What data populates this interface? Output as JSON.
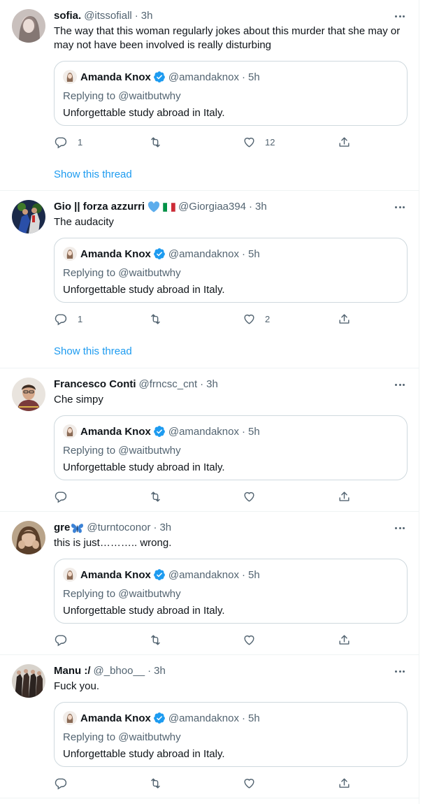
{
  "colors": {
    "accent": "#1d9bf0",
    "muted": "#536471",
    "text": "#0f1419",
    "border": "#cfd9de",
    "verified": "#1d9bf0"
  },
  "icons": {
    "reply": "reply-icon",
    "retweet": "retweet-icon",
    "like": "heart-icon",
    "share": "share-icon",
    "more": "more-icon",
    "verified": "verified-badge-icon"
  },
  "tweets": [
    {
      "name": "sofia.",
      "handle": "@itssofiall",
      "dot": "·",
      "time": "3h",
      "text": "The way that this woman regularly jokes about this murder that she may or may not have been involved is really disturbing",
      "quote": {
        "name": "Amanda Knox",
        "handle": "@amandaknox",
        "dot": "·",
        "time": "5h",
        "reply": "Replying to @waitbutwhy",
        "text": "Unforgettable study abroad in Italy."
      },
      "replies": "1",
      "retweets": "",
      "likes": "12",
      "thread": "Show this thread"
    },
    {
      "name": "Gio || forza azzurri",
      "handle": "@Giorgiaa394",
      "dot": "·",
      "time": "3h",
      "text": "The audacity",
      "quote": {
        "name": "Amanda Knox",
        "handle": "@amandaknox",
        "dot": "·",
        "time": "5h",
        "reply": "Replying to @waitbutwhy",
        "text": "Unforgettable study abroad in Italy."
      },
      "replies": "1",
      "retweets": "",
      "likes": "2",
      "thread": "Show this thread"
    },
    {
      "name": "Francesco Conti",
      "handle": "@frncsc_cnt",
      "dot": "·",
      "time": "3h",
      "text": "Che simpy",
      "quote": {
        "name": "Amanda Knox",
        "handle": "@amandaknox",
        "dot": "·",
        "time": "5h",
        "reply": "Replying to @waitbutwhy",
        "text": "Unforgettable study abroad in Italy."
      },
      "replies": "",
      "retweets": "",
      "likes": ""
    },
    {
      "name": "gre",
      "handle": "@turntoconor",
      "dot": "·",
      "time": "3h",
      "text": "this is just……….. wrong.",
      "quote": {
        "name": "Amanda Knox",
        "handle": "@amandaknox",
        "dot": "·",
        "time": "5h",
        "reply": "Replying to @waitbutwhy",
        "text": "Unforgettable study abroad in Italy."
      },
      "replies": "",
      "retweets": "",
      "likes": ""
    },
    {
      "name": "Manu :/",
      "handle": "@_bhoo__",
      "dot": "·",
      "time": "3h",
      "text": "Fuck you.",
      "quote": {
        "name": "Amanda Knox",
        "handle": "@amandaknox",
        "dot": "·",
        "time": "5h",
        "reply": "Replying to @waitbutwhy",
        "text": "Unforgettable study abroad in Italy."
      },
      "replies": "",
      "retweets": "",
      "likes": ""
    }
  ]
}
